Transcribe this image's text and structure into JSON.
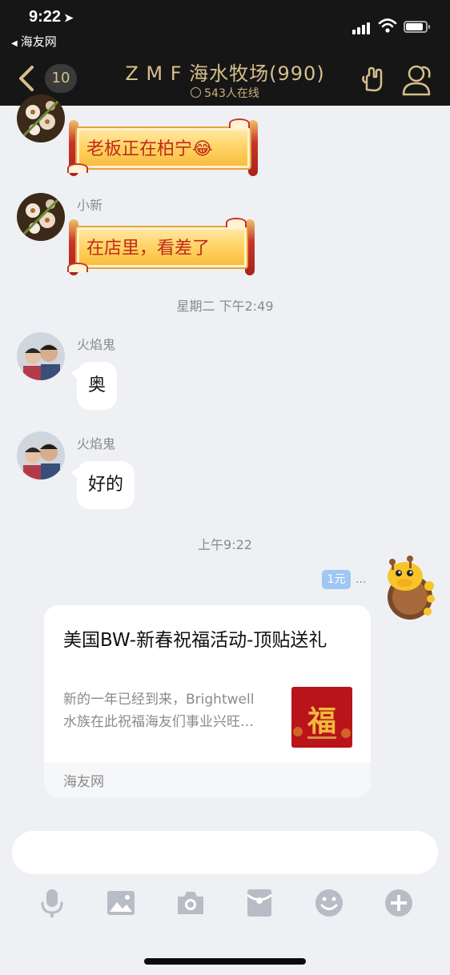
{
  "status_bar": {
    "time": "9:22",
    "back_app": "海友网"
  },
  "nav": {
    "unread_count": "10",
    "title": "Z M F 海水牧场(990)",
    "online": "543人在线",
    "accent_color": "#d6c08a"
  },
  "messages": [
    {
      "sender": "小新",
      "text": "老板正在柏宁😂"
    },
    {
      "sender": "小新",
      "text": "在店里，看差了"
    },
    {
      "timestamp": "星期二 下午2:49"
    },
    {
      "sender": "火焰鬼",
      "text": "奥"
    },
    {
      "sender": "火焰鬼",
      "text": "好的"
    },
    {
      "timestamp": "上午9:22"
    }
  ],
  "outgoing": {
    "pay_badge": "1元",
    "typing": "···"
  },
  "share_card": {
    "title": "美国BW-新春祝福活动-顶贴送礼",
    "description": "新的一年已经到来，Brightwell\n水族在此祝福海友们事业兴旺…",
    "thumb_glyph": "福",
    "source": "海友网"
  },
  "input": {
    "value": "",
    "placeholder": ""
  },
  "toolbar": {
    "icons": [
      "microphone-icon",
      "image-icon",
      "camera-icon",
      "red-packet-icon",
      "emoji-icon",
      "plus-icon"
    ]
  }
}
